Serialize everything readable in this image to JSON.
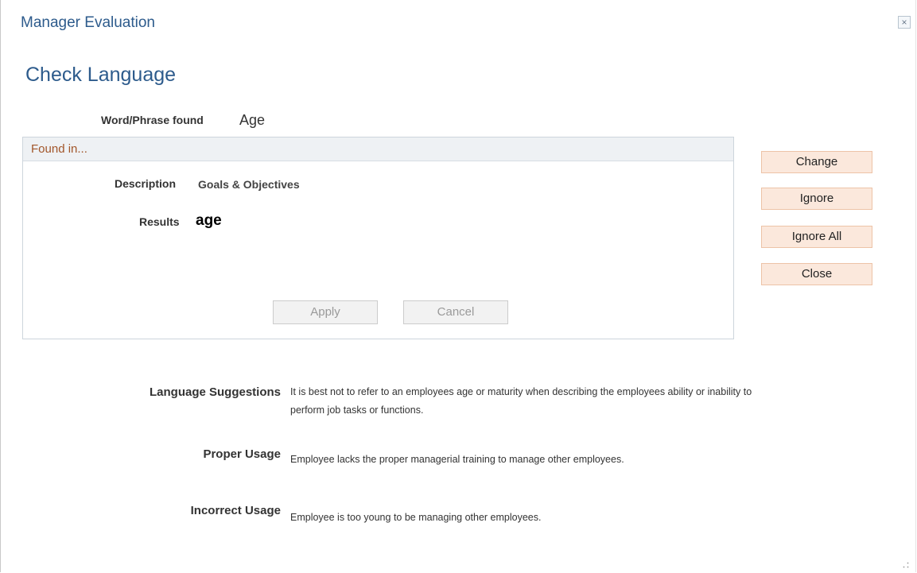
{
  "window": {
    "title": "Manager Evaluation",
    "close_glyph": "×"
  },
  "page": {
    "title": "Check Language"
  },
  "word_found": {
    "label": "Word/Phrase found",
    "value": "Age"
  },
  "found_in": {
    "header": "Found in...",
    "description_label": "Description",
    "description_value": "Goals & Objectives",
    "results_label": "Results",
    "results_value": "age",
    "apply_label": "Apply",
    "cancel_label": "Cancel"
  },
  "actions": {
    "change_label": "Change",
    "ignore_label": "Ignore",
    "ignore_all_label": "Ignore All",
    "close_label": "Close"
  },
  "suggestions": {
    "language_label": "Language Suggestions",
    "language_text_line1": "It is best not to refer to an employees age or maturity when describing the employees ability or inability to",
    "language_text_line2": "perform job tasks or functions.",
    "proper_label": "Proper Usage",
    "proper_text": "Employee lacks the proper managerial training to manage other employees.",
    "incorrect_label": "Incorrect Usage",
    "incorrect_text": "Employee is too young to be managing other employees."
  },
  "colors": {
    "title_blue": "#2d5b8c",
    "section_header_text": "#a2562a",
    "action_button_bg": "#fbe8dc",
    "action_button_border": "#edc3a7"
  },
  "icons": {
    "close": "close-icon",
    "resize": "resize-grip-icon"
  }
}
